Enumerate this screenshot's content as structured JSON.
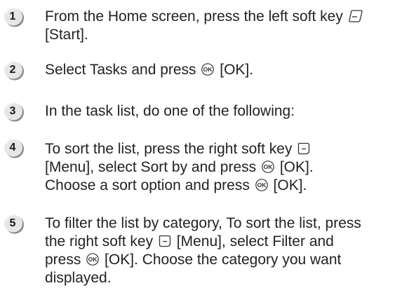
{
  "steps": [
    {
      "number": "1",
      "lines": [
        [
          "From the Home screen, press the left soft key ",
          {
            "icon": "left-soft-key-icon"
          }
        ],
        [
          "[Start]."
        ]
      ]
    },
    {
      "number": "2",
      "lines": [
        [
          "Select Tasks and press ",
          {
            "icon": "ok-key-icon"
          },
          " [OK]."
        ]
      ]
    },
    {
      "number": "3",
      "lines": [
        [
          "In the task list, do one of the following:"
        ]
      ]
    },
    {
      "number": "4",
      "lines": [
        [
          "To sort the list, press the right soft key ",
          {
            "icon": "right-soft-key-icon"
          }
        ],
        [
          "[Menu], select Sort by and press ",
          {
            "icon": "ok-key-icon"
          },
          " [OK]."
        ],
        [
          "Choose a sort option and press ",
          {
            "icon": "ok-key-icon"
          },
          " [OK]."
        ]
      ]
    },
    {
      "number": "5",
      "lines": [
        [
          "To filter the list by category, To sort the list, press"
        ],
        [
          "the right soft key ",
          {
            "icon": "right-soft-key-icon"
          },
          " [Menu], select Filter and"
        ],
        [
          "press ",
          {
            "icon": "ok-key-icon"
          },
          " [OK]. Choose the category you want"
        ],
        [
          "displayed."
        ]
      ]
    }
  ],
  "colors": {
    "badge_fill": "#e6e6e6",
    "badge_shadow": "#8a8a8a",
    "text": "#222222",
    "icon_stroke": "#333333"
  }
}
